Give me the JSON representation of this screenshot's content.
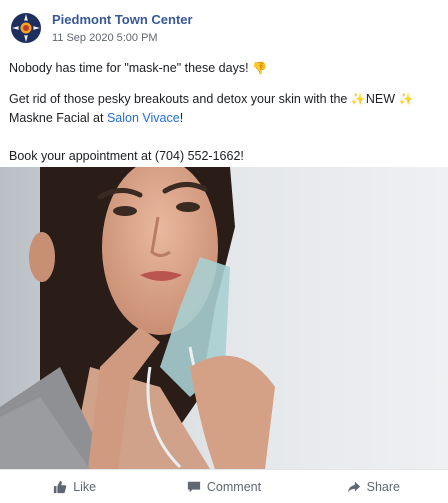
{
  "post": {
    "page_name": "Piedmont Town Center",
    "timestamp": "11 Sep 2020 5:00 PM",
    "line1_text": "Nobody has time for \"mask-ne\" these days!",
    "line2_before": "Get rid of those pesky breakouts and detox your skin with the",
    "line2_new": "NEW",
    "line2_after": "Maskne Facial at",
    "salon_link": "Salon Vivace",
    "line2_end": "!",
    "line3_text": "Book your appointment at (704) 552-1662!",
    "photo_icon": "woman-with-face-mask-photo"
  },
  "actions": {
    "like_label": "Like",
    "comment_label": "Comment",
    "share_label": "Share"
  },
  "colors": {
    "page_name": "#385898",
    "link": "#216fdb",
    "secondary_text": "#606770"
  }
}
